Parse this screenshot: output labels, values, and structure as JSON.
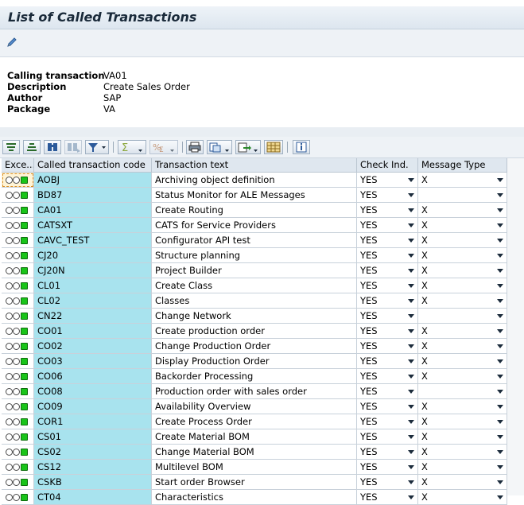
{
  "window": {
    "title": "List of Called Transactions"
  },
  "toolbar": {
    "edit_icon": "pencil-icon"
  },
  "header": {
    "fields": [
      {
        "key": "Calling transaction",
        "value": "VA01"
      },
      {
        "key": "Description",
        "value": "Create Sales Order"
      },
      {
        "key": "Author",
        "value": "SAP"
      },
      {
        "key": "Package",
        "value": "VA"
      }
    ]
  },
  "alv_toolbar": {
    "icons": [
      "sort-ascending-icon",
      "sort-descending-icon",
      "find-icon",
      "find-next-icon",
      "filter-icon",
      "sum-icon",
      "subtotal-icon",
      "print-icon",
      "views-icon",
      "export-icon",
      "layout-icon",
      "info-icon"
    ]
  },
  "table": {
    "columns": [
      "Exce...",
      "Called transaction code",
      "Transaction text",
      "Check Ind.",
      "Message Type"
    ],
    "rows": [
      {
        "code": "AOBJ",
        "text": "Archiving object definition",
        "check": "YES",
        "msg": "X"
      },
      {
        "code": "BD87",
        "text": "Status Monitor for ALE Messages",
        "check": "YES",
        "msg": ""
      },
      {
        "code": "CA01",
        "text": "Create Routing",
        "check": "YES",
        "msg": "X"
      },
      {
        "code": "CATSXT",
        "text": "CATS for Service Providers",
        "check": "YES",
        "msg": "X"
      },
      {
        "code": "CAVC_TEST",
        "text": "Configurator API test",
        "check": "YES",
        "msg": "X"
      },
      {
        "code": "CJ20",
        "text": "Structure planning",
        "check": "YES",
        "msg": "X"
      },
      {
        "code": "CJ20N",
        "text": "Project Builder",
        "check": "YES",
        "msg": "X"
      },
      {
        "code": "CL01",
        "text": "Create Class",
        "check": "YES",
        "msg": "X"
      },
      {
        "code": "CL02",
        "text": "Classes",
        "check": "YES",
        "msg": "X"
      },
      {
        "code": "CN22",
        "text": "Change Network",
        "check": "YES",
        "msg": ""
      },
      {
        "code": "CO01",
        "text": "Create production order",
        "check": "YES",
        "msg": "X"
      },
      {
        "code": "CO02",
        "text": "Change Production Order",
        "check": "YES",
        "msg": "X"
      },
      {
        "code": "CO03",
        "text": "Display Production Order",
        "check": "YES",
        "msg": "X"
      },
      {
        "code": "CO06",
        "text": "Backorder Processing",
        "check": "YES",
        "msg": "X"
      },
      {
        "code": "CO08",
        "text": "Production order with sales order",
        "check": "YES",
        "msg": ""
      },
      {
        "code": "CO09",
        "text": "Availability Overview",
        "check": "YES",
        "msg": "X"
      },
      {
        "code": "COR1",
        "text": "Create Process Order",
        "check": "YES",
        "msg": "X"
      },
      {
        "code": "CS01",
        "text": "Create Material BOM",
        "check": "YES",
        "msg": "X"
      },
      {
        "code": "CS02",
        "text": "Change Material BOM",
        "check": "YES",
        "msg": "X"
      },
      {
        "code": "CS12",
        "text": "Multilevel BOM",
        "check": "YES",
        "msg": "X"
      },
      {
        "code": "CSKB",
        "text": "Start order Browser",
        "check": "YES",
        "msg": "X"
      },
      {
        "code": "CT04",
        "text": "Characteristics",
        "check": "YES",
        "msg": "X"
      }
    ]
  }
}
